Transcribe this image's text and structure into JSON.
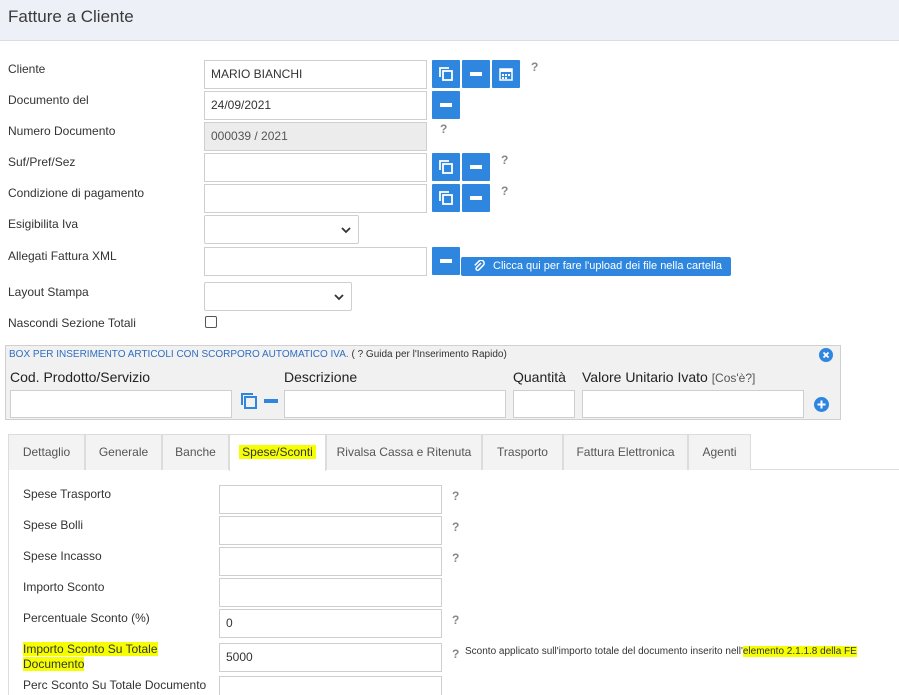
{
  "page": {
    "title": "Fatture a Cliente"
  },
  "form": {
    "cliente": {
      "label": "Cliente",
      "value": "MARIO BIANCHI"
    },
    "documento_del": {
      "label": "Documento del",
      "value": "24/09/2021"
    },
    "numero_documento": {
      "label": "Numero Documento",
      "value": "000039 / 2021"
    },
    "suf_pref_sez": {
      "label": "Suf/Pref/Sez",
      "value": ""
    },
    "condizione_pagamento": {
      "label": "Condizione di pagamento",
      "value": ""
    },
    "esigibilita_iva": {
      "label": "Esigibilita Iva",
      "value": ""
    },
    "allegati_xml": {
      "label": "Allegati Fattura XML",
      "value": "",
      "upload_label": "Clicca qui per fare l'upload dei file nella cartella"
    },
    "layout_stampa": {
      "label": "Layout Stampa",
      "value": ""
    },
    "nascondi_totali": {
      "label": "Nascondi Sezione Totali",
      "checked": false
    },
    "help_mark": "?"
  },
  "quick_box": {
    "title": "BOX PER INSERIMENTO ARTICOLI CON SCORPORO AUTOMATICO IVA.",
    "guide": "( ? Guida per l'Inserimento Rapido)",
    "columns": {
      "codice": "Cod. Prodotto/Servizio",
      "descrizione": "Descrizione",
      "quantita": "Quantità",
      "valore": "Valore Unitario Ivato",
      "valore_help": "[Cos'è?]"
    }
  },
  "tabs": [
    {
      "label": "Dettaglio",
      "active": false
    },
    {
      "label": "Generale",
      "active": false
    },
    {
      "label": "Banche",
      "active": false
    },
    {
      "label": "Spese/Sconti",
      "active": true
    },
    {
      "label": "Rivalsa Cassa e Ritenuta",
      "active": false
    },
    {
      "label": "Trasporto",
      "active": false
    },
    {
      "label": "Fattura Elettronica",
      "active": false
    },
    {
      "label": "Agenti",
      "active": false
    }
  ],
  "spese": {
    "trasporto": {
      "label": "Spese Trasporto",
      "value": ""
    },
    "bolli": {
      "label": "Spese Bolli",
      "value": ""
    },
    "incasso": {
      "label": "Spese Incasso",
      "value": ""
    },
    "importo_sconto": {
      "label": "Importo Sconto",
      "value": ""
    },
    "percentuale_sconto": {
      "label": "Percentuale Sconto (%)",
      "value": "0"
    },
    "importo_sconto_totale": {
      "label_line1": "Importo Sconto Su Totale",
      "label_line2": "Documento",
      "value": "5000"
    },
    "perc_sconto_totale": {
      "label": "Perc Sconto Su Totale Documento",
      "value": ""
    },
    "note_prefix": "Sconto applicato sull'importo totale del documento inserito nell'",
    "note_highlight": "elemento 2.1.1.8 della FE"
  },
  "colors": {
    "accent": "#2f86de",
    "highlight": "#f6ff00",
    "header_bg": "#edf1f7"
  }
}
